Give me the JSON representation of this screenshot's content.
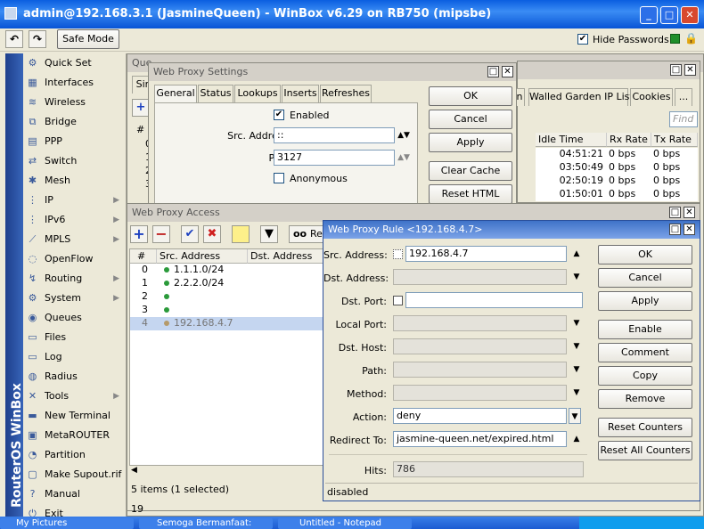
{
  "titlebar": {
    "title": "admin@192.168.3.1 (JasmineQueen) - WinBox v6.29 on RB750 (mipsbe)"
  },
  "toolbar": {
    "safe_mode": "Safe Mode",
    "hide_passwords": "Hide Passwords"
  },
  "sidebar": {
    "brand": "RouterOS WinBox",
    "items": [
      {
        "label": "Quick Set",
        "icon": "quick-set-icon"
      },
      {
        "label": "Interfaces",
        "icon": "interfaces-icon"
      },
      {
        "label": "Wireless",
        "icon": "wireless-icon"
      },
      {
        "label": "Bridge",
        "icon": "bridge-icon"
      },
      {
        "label": "PPP",
        "icon": "ppp-icon"
      },
      {
        "label": "Switch",
        "icon": "switch-icon"
      },
      {
        "label": "Mesh",
        "icon": "mesh-icon"
      },
      {
        "label": "IP",
        "icon": "ip-icon"
      },
      {
        "label": "IPv6",
        "icon": "ipv6-icon"
      },
      {
        "label": "MPLS",
        "icon": "mpls-icon"
      },
      {
        "label": "OpenFlow",
        "icon": "openflow-icon"
      },
      {
        "label": "Routing",
        "icon": "routing-icon"
      },
      {
        "label": "System",
        "icon": "system-icon"
      },
      {
        "label": "Queues",
        "icon": "queues-icon"
      },
      {
        "label": "Files",
        "icon": "files-icon"
      },
      {
        "label": "Log",
        "icon": "log-icon"
      },
      {
        "label": "Radius",
        "icon": "radius-icon"
      },
      {
        "label": "Tools",
        "icon": "tools-icon"
      },
      {
        "label": "New Terminal",
        "icon": "terminal-icon"
      },
      {
        "label": "MetaROUTER",
        "icon": "metarouter-icon"
      },
      {
        "label": "Partition",
        "icon": "partition-icon"
      },
      {
        "label": "Make Supout.rif",
        "icon": "supout-icon"
      },
      {
        "label": "Manual",
        "icon": "manual-icon"
      },
      {
        "label": "Exit",
        "icon": "exit-icon"
      }
    ]
  },
  "bg_window": {
    "title_partial": "Que",
    "tab_partial": "Sim",
    "tabs": [
      "n",
      "Walled Garden IP List",
      "Cookies",
      "..."
    ],
    "find_placeholder": "Find",
    "columns": [
      "Idle Time",
      "Rx Rate",
      "Tx Rate"
    ],
    "rows": [
      {
        "idle": "04:51:21",
        "rx": "0 bps",
        "tx": "0 bps"
      },
      {
        "idle": "03:50:49",
        "rx": "0 bps",
        "tx": "0 bps"
      },
      {
        "idle": "02:50:19",
        "rx": "0 bps",
        "tx": "0 bps"
      },
      {
        "idle": "01:50:01",
        "rx": "0 bps",
        "tx": "0 bps"
      }
    ],
    "left_hash": "#",
    "left_rows": [
      "0",
      "1",
      "2",
      "3"
    ]
  },
  "proxy_settings": {
    "title": "Web Proxy Settings",
    "tabs": [
      "General",
      "Status",
      "Lookups",
      "Inserts",
      "Refreshes"
    ],
    "enabled_label": "Enabled",
    "src_address_label": "Src. Address:",
    "src_address_value": "::",
    "port_label": "Port:",
    "port_value": "3127",
    "anonymous_label": "Anonymous",
    "buttons": [
      "OK",
      "Cancel",
      "Apply",
      "Clear Cache",
      "Reset HTML"
    ]
  },
  "proxy_access": {
    "title": "Web Proxy Access",
    "toolbar_extra": "Re",
    "columns": [
      "#",
      "Src. Address",
      "Dst. Address"
    ],
    "rows": [
      {
        "num": "0",
        "src": "1.1.1.0/24"
      },
      {
        "num": "1",
        "src": "2.2.2.0/24"
      },
      {
        "num": "2",
        "src": ""
      },
      {
        "num": "3",
        "src": ""
      },
      {
        "num": "4",
        "src": "192.168.4.7"
      }
    ],
    "status": "5 items (1 selected)",
    "bottom_partial": "19"
  },
  "proxy_rule": {
    "title": "Web Proxy Rule <192.168.4.7>",
    "fields": {
      "src_address": {
        "label": "Src. Address:",
        "value": "192.168.4.7"
      },
      "dst_address": {
        "label": "Dst. Address:",
        "value": ""
      },
      "dst_port": {
        "label": "Dst. Port:",
        "value": ""
      },
      "local_port": {
        "label": "Local Port:",
        "value": ""
      },
      "dst_host": {
        "label": "Dst. Host:",
        "value": ""
      },
      "path": {
        "label": "Path:",
        "value": ""
      },
      "method": {
        "label": "Method:",
        "value": ""
      },
      "action": {
        "label": "Action:",
        "value": "deny"
      },
      "redirect_to": {
        "label": "Redirect To:",
        "value": "jasmine-queen.net/expired.html"
      },
      "hits": {
        "label": "Hits:",
        "value": "786"
      }
    },
    "buttons": [
      "OK",
      "Cancel",
      "Apply",
      "Enable",
      "Comment",
      "Copy",
      "Remove",
      "Reset Counters",
      "Reset All Counters"
    ],
    "status": "disabled"
  },
  "taskbar": {
    "items": [
      "My Pictures",
      "Semoga Bermanfaat:",
      "Untitled - Notepad"
    ]
  }
}
